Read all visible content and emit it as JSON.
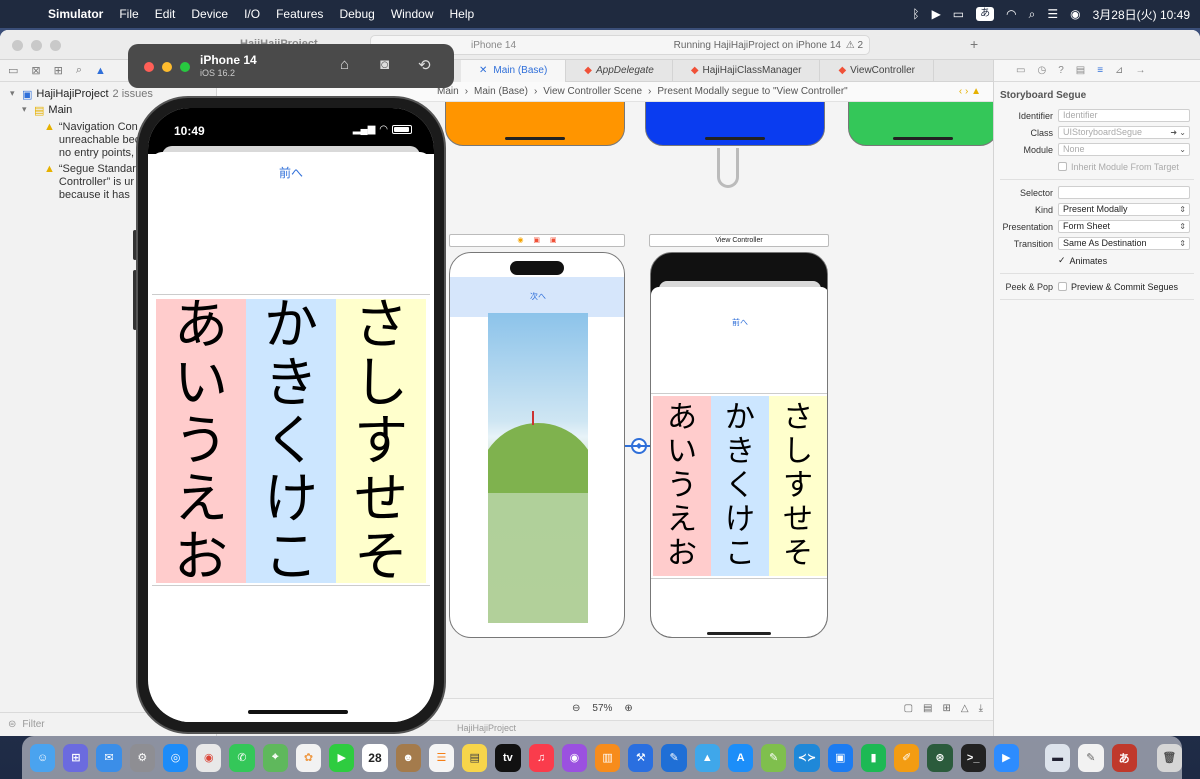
{
  "menubar": {
    "app": "Simulator",
    "items": [
      "File",
      "Edit",
      "Device",
      "I/O",
      "Features",
      "Debug",
      "Window",
      "Help"
    ],
    "ime": "あ",
    "datetime": "3月28日(火) 10:49"
  },
  "xcode": {
    "project_name": "HajiHajiProject",
    "destination": "iPhone 14",
    "run_status": "Running HajiHajiProject on iPhone 14",
    "issue_count": "2",
    "tabs": [
      "Main (Base)",
      "AppDelegate",
      "HajiHajiClassManager",
      "ViewController"
    ],
    "breadcrumb": [
      "Main",
      "Main (Base)",
      "View Controller Scene",
      "Present Modally segue to \"View Controller\""
    ]
  },
  "navigator": {
    "project": "HajiHajiProject",
    "issues_label": "2 issues",
    "group": "Main",
    "issues": [
      {
        "lines": [
          "“Navigation Con",
          "unreachable bec",
          "no entry points,"
        ]
      },
      {
        "lines": [
          "“Segue Standar",
          "Controller” is ur",
          "because it has"
        ]
      }
    ],
    "filter_placeholder": "Filter"
  },
  "canvas": {
    "scene2_next": "次へ",
    "scene3_label": "View Controller",
    "scene3_prev": "前へ",
    "zoom_level": "57%",
    "debug_project": "HajiHajiProject",
    "top_scene_colors": [
      "#ff9500",
      "#0a3cf0",
      "#34c759"
    ]
  },
  "kana": {
    "columns": [
      {
        "chars": [
          "あ",
          "い",
          "う",
          "え",
          "お"
        ],
        "color": "#ffcccc"
      },
      {
        "chars": [
          "か",
          "き",
          "く",
          "け",
          "こ"
        ],
        "color": "#cce6ff"
      },
      {
        "chars": [
          "さ",
          "し",
          "す",
          "せ",
          "そ"
        ],
        "color": "#ffffcc"
      }
    ]
  },
  "inspector": {
    "title": "Storyboard Segue",
    "identifier_label": "Identifier",
    "identifier_placeholder": "Identifier",
    "class_label": "Class",
    "class_value": "UIStoryboardSegue",
    "module_label": "Module",
    "module_value": "None",
    "inherit_label": "Inherit Module From Target",
    "selector_label": "Selector",
    "kind_label": "Kind",
    "kind_value": "Present Modally",
    "presentation_label": "Presentation",
    "presentation_value": "Form Sheet",
    "transition_label": "Transition",
    "transition_value": "Same As Destination",
    "animates_label": "Animates",
    "peek_label": "Peek & Pop",
    "peek_value": "Preview & Commit Segues"
  },
  "simulator": {
    "device": "iPhone 14",
    "os": "iOS 16.2",
    "time": "10:49",
    "prev_label": "前へ"
  },
  "dock": {
    "calendar_day": "28",
    "ime": "あ"
  }
}
